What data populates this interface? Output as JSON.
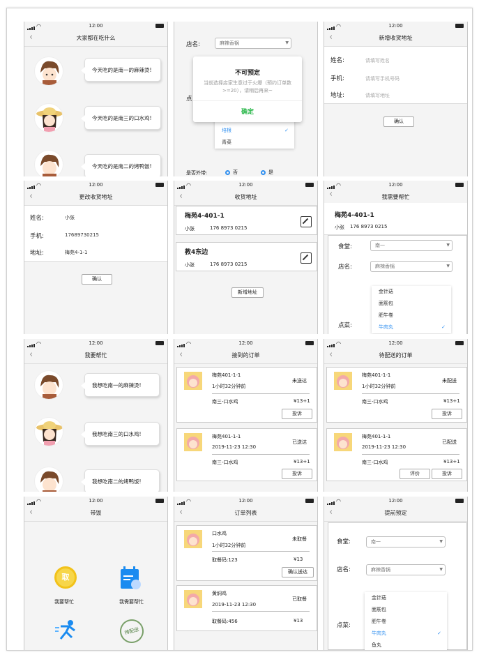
{
  "status": {
    "time": "12:00"
  },
  "s1": {
    "title": "大家都在吃什么",
    "items": [
      {
        "text": "今天吃的是南一的麻辣烫!"
      },
      {
        "text": "今天吃的是南三的口水鸡!"
      },
      {
        "text": "今天吃的是南二的烤鸭饭!"
      }
    ]
  },
  "s2": {
    "shop_label": "店名:",
    "shop_value": "麻辣香锅",
    "dish_label": "点",
    "dialog_title": "不可预定",
    "dialog_text": "当前选择店家生意过于火爆（预约订单数>=20），请稍后再来~",
    "dialog_ok": "确定",
    "options": [
      "面筋",
      "培根",
      "青菜"
    ],
    "takeaway_label": "是否外带:",
    "opt_no": "否",
    "opt_yes": "是"
  },
  "s3": {
    "title": "新增收货地址",
    "name_label": "姓名:",
    "name_ph": "请填写姓名",
    "phone_label": "手机:",
    "phone_ph": "请填写手机号码",
    "addr_label": "地址:",
    "addr_ph": "请填写地址",
    "confirm": "确认"
  },
  "s4": {
    "title": "更改收货地址",
    "name_label": "姓名:",
    "name_val": "小张",
    "phone_label": "手机:",
    "phone_val": "17689730215",
    "addr_label": "地址:",
    "addr_val": "梅苑4-1-1",
    "confirm": "确认"
  },
  "s5": {
    "title": "收货地址",
    "cards": [
      {
        "addr": "梅苑4-401-1",
        "name": "小张",
        "phone": "176 8973 0215"
      },
      {
        "addr": "教4东边",
        "name": "小张",
        "phone": "176 8973 0215"
      }
    ],
    "add": "新增地址"
  },
  "s6": {
    "title": "我需要帮忙",
    "addr": "梅苑4-401-1",
    "name": "小张",
    "phone": "176 8973 0215",
    "canteen_label": "食堂:",
    "canteen_val": "南一",
    "shop_label": "店名:",
    "shop_val": "麻辣香锅",
    "dish_label": "点菜:",
    "options": [
      "金针菇",
      "面筋包",
      "肥牛卷",
      "牛肉丸"
    ]
  },
  "s7": {
    "title": "我要帮忙",
    "items": [
      {
        "text": "我想吃南一的麻辣烫!"
      },
      {
        "text": "我想吃南三的口水鸡!"
      },
      {
        "text": "我想吃南二的烤鸭饭!"
      }
    ]
  },
  "s8": {
    "title": "接到的订单",
    "orders": [
      {
        "addr": "梅苑401-1-1",
        "time": "1小时32分钟前",
        "status": "未送达",
        "dish": "南三-口水鸡",
        "price": "¥13+1",
        "btn": "投诉"
      },
      {
        "addr": "梅苑401-1-1",
        "time": "2019-11-23 12:30",
        "status": "已送达",
        "dish": "南三-口水鸡",
        "price": "¥13+1",
        "btn": "投诉"
      }
    ]
  },
  "s9": {
    "title": "待配送的订单",
    "orders": [
      {
        "addr": "梅苑401-1-1",
        "time": "1小时32分钟前",
        "status": "未配送",
        "dish": "南三-口水鸡",
        "price": "¥13+1",
        "btn": "投诉"
      },
      {
        "addr": "梅苑401-1-1",
        "time": "2019-11-23 12:30",
        "status": "已配送",
        "dish": "南三-口水鸡",
        "price": "¥13+1",
        "btn": "投诉",
        "btn2": "评价"
      }
    ]
  },
  "s10": {
    "title": "带饭",
    "icon1_char": "取",
    "btn1": "我要帮忙",
    "btn2": "我需要帮忙",
    "stamp": "待配送"
  },
  "s11": {
    "title": "订单列表",
    "orders": [
      {
        "dish": "口水鸡",
        "time": "1小时32分钟前",
        "status": "未取餐",
        "code": "取餐码:123",
        "price": "¥13",
        "btn": "确认送达"
      },
      {
        "dish": "黄焖鸡",
        "time": "2019-11-23 12:30",
        "status": "已取餐",
        "code": "取餐码:456",
        "price": "¥13"
      }
    ]
  },
  "s12": {
    "title": "提前预定",
    "canteen_label": "食堂:",
    "canteen_val": "南一",
    "shop_label": "店名:",
    "shop_val": "麻辣香锅",
    "dish_label": "点菜:",
    "options": [
      "金针菇",
      "面筋包",
      "肥牛卷",
      "牛肉丸",
      "鱼丸"
    ]
  }
}
